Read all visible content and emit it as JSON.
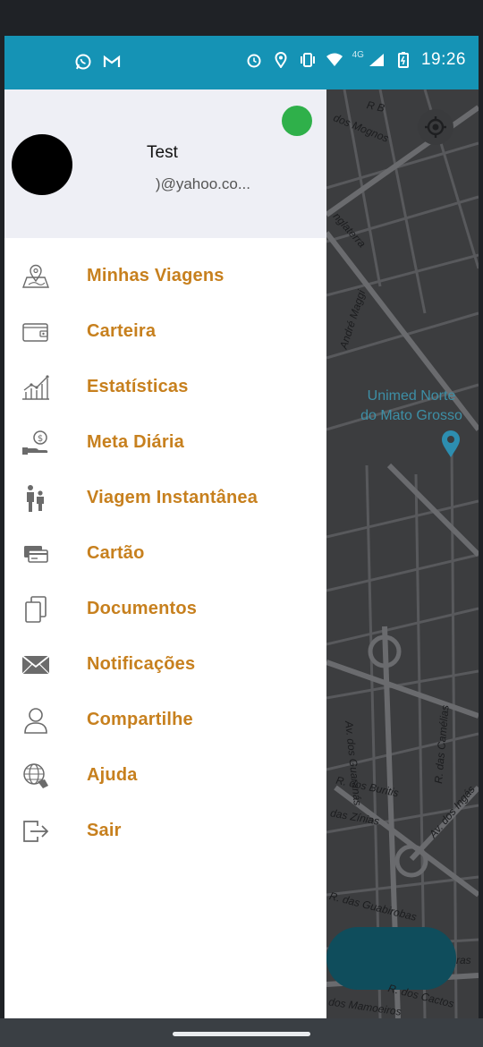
{
  "status_bar": {
    "network": "4G",
    "time": "19:26"
  },
  "drawer": {
    "user": {
      "name": "Test",
      "email": ")@yahoo.co..."
    },
    "menu": [
      {
        "label": "Minhas Viagens",
        "icon": "map-pin-icon"
      },
      {
        "label": "Carteira",
        "icon": "wallet-icon"
      },
      {
        "label": "Estatísticas",
        "icon": "chart-icon"
      },
      {
        "label": "Meta Diária",
        "icon": "money-hand-icon"
      },
      {
        "label": "Viagem Instantânea",
        "icon": "people-icon"
      },
      {
        "label": "Cartão",
        "icon": "card-icon"
      },
      {
        "label": "Documentos",
        "icon": "documents-icon"
      },
      {
        "label": "Notificações",
        "icon": "envelope-icon"
      },
      {
        "label": "Compartilhe",
        "icon": "user-icon"
      },
      {
        "label": "Ajuda",
        "icon": "globe-help-icon"
      },
      {
        "label": "Sair",
        "icon": "exit-icon"
      }
    ],
    "label_color": "#c7801e"
  },
  "map": {
    "street_labels": {
      "rb": "R B",
      "mognos": "dos Mognos",
      "inglaterra": "nglaterra",
      "andre_maggi": "André Maggi",
      "guaranas": "Av. dos Guaranás",
      "camelias": "R. das Camélias",
      "buritis": "R. dos Buritis",
      "zinias": "das Zínias",
      "ingas": "Av. dos Ingás",
      "guabirobas": "R. das Guabirobas",
      "ras": "ras",
      "cactos": "R. dos Cactos",
      "mamoeiros": "dos Mamoeiros"
    },
    "poi": {
      "line1": "Unimed Norte",
      "line2": "do Mato Grosso"
    }
  }
}
